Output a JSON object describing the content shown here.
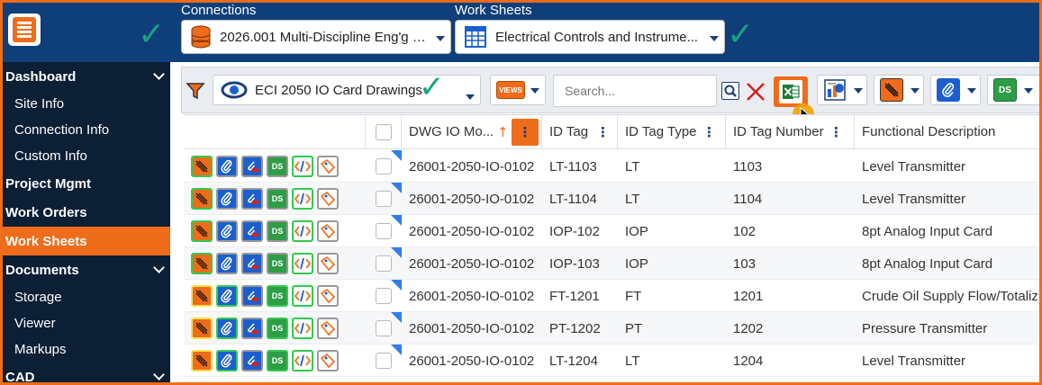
{
  "topbar": {
    "connections_label": "Connections",
    "connection_value": "2026.001 Multi-Discipline Eng'g a...",
    "worksheets_label": "Work Sheets",
    "worksheet_value": "Electrical Controls and Instrume..."
  },
  "sidebar": {
    "items": [
      {
        "label": "Dashboard",
        "kind": "head",
        "expandable": true
      },
      {
        "label": "Site Info",
        "kind": "sub"
      },
      {
        "label": "Connection Info",
        "kind": "sub"
      },
      {
        "label": "Custom Info",
        "kind": "sub"
      },
      {
        "label": "Project Mgmt",
        "kind": "head"
      },
      {
        "label": "Work Orders",
        "kind": "head"
      },
      {
        "label": "Work Sheets",
        "kind": "head",
        "active": true
      },
      {
        "label": "Documents",
        "kind": "head",
        "expandable": true
      },
      {
        "label": "Storage",
        "kind": "sub"
      },
      {
        "label": "Viewer",
        "kind": "sub"
      },
      {
        "label": "Markups",
        "kind": "sub"
      },
      {
        "label": "CAD",
        "kind": "head",
        "expandable": true
      }
    ]
  },
  "toolbar": {
    "view_value": "ECI 2050 IO Card Drawings",
    "views_icon_text": "VIEWS",
    "search_placeholder": "Search...",
    "ds_icon_text": "DS"
  },
  "grid": {
    "columns": [
      "DWG IO Mo...",
      "ID Tag",
      "ID Tag Type",
      "ID Tag Number",
      "Functional Description"
    ],
    "sort_indicator": "↑",
    "rows": [
      {
        "dwg": "26001-2050-IO-0102",
        "tag": "LT-1103",
        "type": "LT",
        "number": "1103",
        "desc": "Level Transmitter",
        "variant": "green"
      },
      {
        "dwg": "26001-2050-IO-0102",
        "tag": "LT-1104",
        "type": "LT",
        "number": "1104",
        "desc": "Level Transmitter",
        "variant": "green"
      },
      {
        "dwg": "26001-2050-IO-0102",
        "tag": "IOP-102",
        "type": "IOP",
        "number": "102",
        "desc": "8pt Analog Input Card",
        "variant": "green"
      },
      {
        "dwg": "26001-2050-IO-0102",
        "tag": "IOP-103",
        "type": "IOP",
        "number": "103",
        "desc": "8pt Analog Input Card",
        "variant": "green"
      },
      {
        "dwg": "26001-2050-IO-0102",
        "tag": "FT-1201",
        "type": "FT",
        "number": "1201",
        "desc": "Crude Oil Supply Flow/Totalizing",
        "variant": "yellow"
      },
      {
        "dwg": "26001-2050-IO-0102",
        "tag": "PT-1202",
        "type": "PT",
        "number": "1202",
        "desc": "Pressure Transmitter",
        "variant": "yellow"
      },
      {
        "dwg": "26001-2050-IO-0102",
        "tag": "LT-1204",
        "type": "LT",
        "number": "1204",
        "desc": "Level Transmitter",
        "variant": "yellow"
      }
    ]
  },
  "colors": {
    "accent": "#ef6c1a",
    "header_bg": "#0f3f7a",
    "sidebar_bg": "#0b1f35",
    "check": "#19a37f",
    "link_blue": "#1b3f7a"
  }
}
